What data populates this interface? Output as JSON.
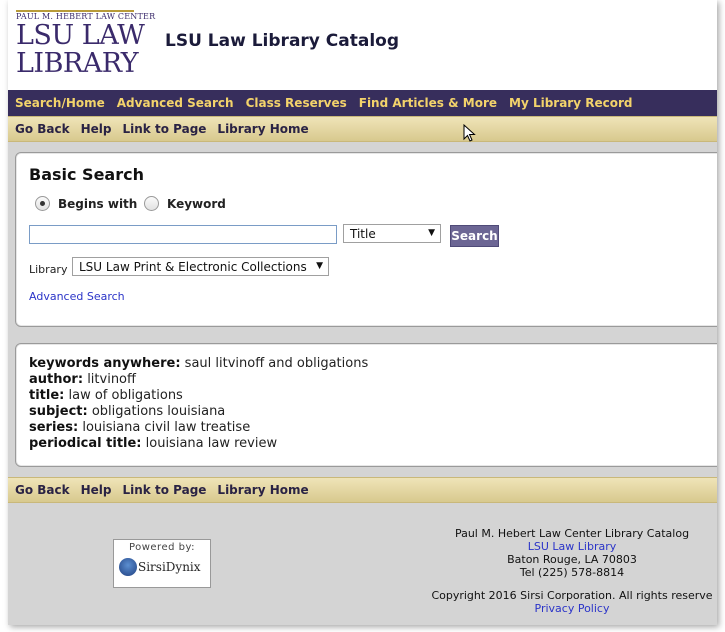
{
  "header": {
    "logo_line1": "PAUL M. HEBERT LAW CENTER",
    "logo_line2": "LSU LAW",
    "logo_line3": "LIBRARY",
    "title": "LSU Law Library Catalog"
  },
  "nav": [
    "Search/Home",
    "Advanced Search",
    "Class Reserves",
    "Find Articles & More",
    "My Library Record"
  ],
  "subnav": [
    "Go Back",
    "Help",
    "Link to Page",
    "Library Home"
  ],
  "search": {
    "heading": "Basic Search",
    "radio_options": [
      {
        "label": "Begins with",
        "checked": true
      },
      {
        "label": "Keyword",
        "checked": false
      }
    ],
    "query_value": "",
    "field_select": "Title",
    "button_label": "Search",
    "library_label": "Library",
    "library_select": "LSU Law Print & Electronic Collections",
    "advanced_link": "Advanced Search"
  },
  "facets": [
    {
      "label": "keywords anywhere:",
      "value": "saul litvinoff and obligations"
    },
    {
      "label": "author:",
      "value": "litvinoff"
    },
    {
      "label": "title:",
      "value": "law of obligations"
    },
    {
      "label": "subject:",
      "value": "obligations louisiana"
    },
    {
      "label": "series:",
      "value": "louisiana civil law treatise"
    },
    {
      "label": "periodical title:",
      "value": "louisiana law review"
    }
  ],
  "footer": {
    "catalog_name": "Paul M. Hebert Law Center Library Catalog",
    "library_link": "LSU Law Library",
    "address": "Baton Rouge, LA 70803",
    "phone": "Tel (225) 578-8814",
    "copyright": "Copyright 2016 Sirsi Corporation. All rights reserve",
    "privacy_link": "Privacy Policy",
    "powered_by": "Powered by:",
    "vendor": "SirsiDynix"
  },
  "colors": {
    "nav_bg": "#372e5c",
    "nav_text": "#f3d36b",
    "subnav_bg": "#e4d7a2",
    "button_bg": "#6c6694",
    "link": "#2b34c8"
  }
}
